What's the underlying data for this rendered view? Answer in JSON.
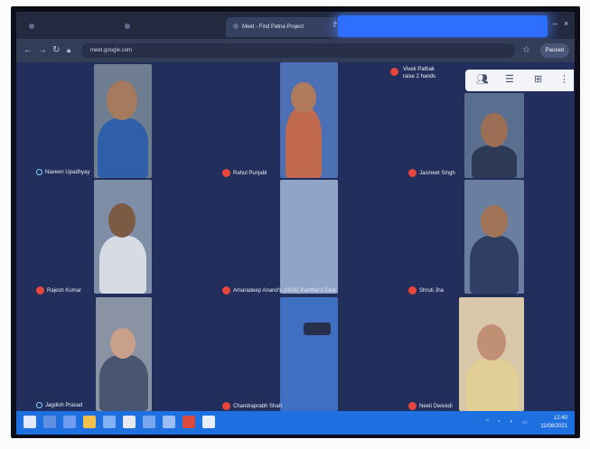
{
  "browser": {
    "tabs": [
      {
        "label": ""
      },
      {
        "label": ""
      },
      {
        "label": "Meet - Find Patna Project"
      }
    ],
    "url": "meet.google.com",
    "profile_label": "Paused"
  },
  "meeting": {
    "raised_hand": {
      "line1": "Vivek Pathak",
      "line2": "raise 2 hands"
    },
    "participants": [
      {
        "name": "Naveen Upadhyay",
        "mic_muted": false
      },
      {
        "name": "Rahul Punjabi",
        "mic_muted": true
      },
      {
        "name": "Jasmeet Singh",
        "mic_muted": true
      },
      {
        "name": "Rajesh Kumar",
        "mic_muted": true
      },
      {
        "name": "Amaradeep Anand's (2016) Panther's Club",
        "mic_muted": true
      },
      {
        "name": "Shruti Jha",
        "mic_muted": true
      },
      {
        "name": "Jagdish Prasad",
        "mic_muted": false
      },
      {
        "name": "Chandraprabh Shah",
        "mic_muted": true
      },
      {
        "name": "Neeti Dwivedi",
        "mic_muted": true
      }
    ]
  },
  "taskbar": {
    "clock_time": "12:40",
    "clock_date": "11/08/2021"
  },
  "colors": {
    "meet_background": "#222f5c",
    "muted_mic": "#e8453c",
    "taskbar": "#1e6fe0"
  }
}
